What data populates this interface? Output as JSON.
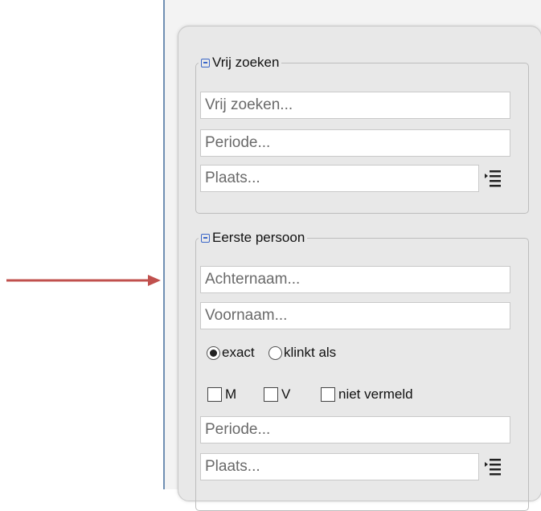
{
  "colors": {
    "arrow": "#c0504d",
    "frame_border": "#6f8fb3",
    "panel_bg": "#e8e8e8",
    "collapse_icon": "#3a66c8"
  },
  "vrij_zoeken": {
    "legend": "Vrij zoeken",
    "free_text_placeholder": "Vrij zoeken...",
    "period_placeholder": "Periode...",
    "place_placeholder": "Plaats...",
    "place_list_icon": "list-icon"
  },
  "eerste_persoon": {
    "legend": "Eerste persoon",
    "lastname_placeholder": "Achternaam...",
    "firstname_placeholder": "Voornaam...",
    "match_options": [
      {
        "label": "exact",
        "checked": true
      },
      {
        "label": "klinkt als",
        "checked": false
      }
    ],
    "gender_options": [
      {
        "label": "M",
        "checked": false
      },
      {
        "label": "V",
        "checked": false
      },
      {
        "label": "niet vermeld",
        "checked": false
      }
    ],
    "period_placeholder": "Periode...",
    "place_placeholder": "Plaats...",
    "place_list_icon": "list-icon"
  }
}
